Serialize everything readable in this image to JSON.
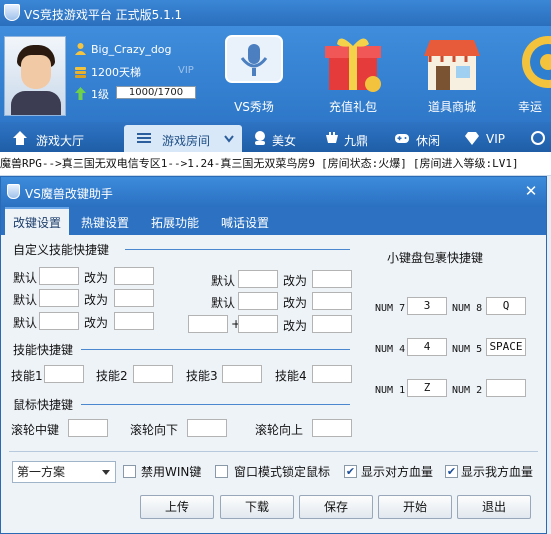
{
  "app": {
    "title": "VS竞技游戏平台 正式版5.1.1"
  },
  "user": {
    "name": "Big_Crazy_dog",
    "rank": "1200天梯",
    "vip": "VIP",
    "level": "1级",
    "exp": "1000/1700",
    "exp_fraction": 0.588
  },
  "header_buttons": [
    "VS秀场",
    "充值礼包",
    "道具商城",
    "幸运"
  ],
  "nav": [
    "游戏大厅",
    "游戏房间",
    "美女",
    "九鼎",
    "休闲",
    "VIP",
    ""
  ],
  "breadcrumb": {
    "path": "魔兽RPG-->真三国无双电信专区1-->1.24-真三国无双菜鸟房9",
    "status": "[房间状态:火爆]",
    "entry_level": "[房间进入等级:LV1]"
  },
  "dialog": {
    "title": "VS魔兽改键助手",
    "tabs": [
      "改键设置",
      "热键设置",
      "拓展功能",
      "喊话设置"
    ],
    "custom_skill_header": "自定义技能快捷键",
    "default_label": "默认",
    "change_label": "改为",
    "plus": "+",
    "skill_header": "技能快捷键",
    "skills": [
      "技能1",
      "技能2",
      "技能3",
      "技能4"
    ],
    "mouse_header": "鼠标快捷键",
    "mouse": [
      "滚轮中键",
      "滚轮向下",
      "滚轮向上"
    ],
    "numpad": {
      "header": "小键盘包裹快捷键",
      "keys": [
        {
          "label": "NUM 7",
          "value": "3"
        },
        {
          "label": "NUM 8",
          "value": "Q"
        },
        {
          "label": "NUM 4",
          "value": "4"
        },
        {
          "label": "NUM 5",
          "value": "SPACE"
        },
        {
          "label": "NUM 1",
          "value": "Z"
        },
        {
          "label": "NUM 2",
          "value": ""
        }
      ]
    },
    "scheme": "第一方案",
    "options": [
      {
        "label": "禁用WIN键",
        "checked": false
      },
      {
        "label": "窗口模式锁定鼠标",
        "checked": false
      },
      {
        "label": "显示对方血量",
        "checked": true
      },
      {
        "label": "显示我方血量",
        "checked": true
      }
    ],
    "buttons": [
      "上传",
      "下载",
      "保存",
      "开始",
      "退出"
    ]
  }
}
